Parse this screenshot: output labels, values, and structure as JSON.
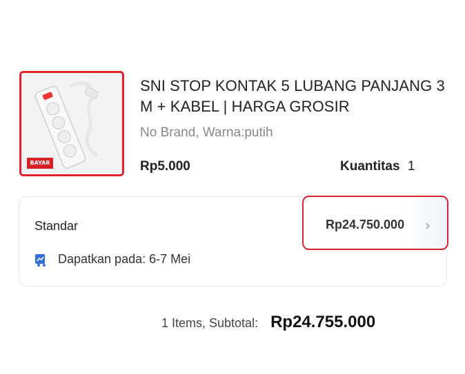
{
  "product": {
    "title": "SNI STOP KONTAK 5 LUBANG PANJANG 3 M + KABEL | HARGA GROSIR",
    "variant": "No Brand, Warna:putih",
    "price": "Rp5.000",
    "quantity_label": "Kuantitas",
    "quantity_value": "1",
    "thumbnail_badge": "BAYAR"
  },
  "shipping": {
    "option_name": "Standar",
    "price": "Rp24.750.000",
    "eta_text": "Dapatkan pada: 6-7 Mei",
    "chevron_icon": "chevron-right-icon",
    "eta_icon": "delivery-truck-icon",
    "highlight_color": "#d5262f"
  },
  "summary": {
    "items_label": "1 Items, Subtotal:",
    "subtotal_value": "Rp24.755.000"
  },
  "colors": {
    "accent_red": "#e0202a",
    "icon_blue": "#2f6fd6"
  }
}
